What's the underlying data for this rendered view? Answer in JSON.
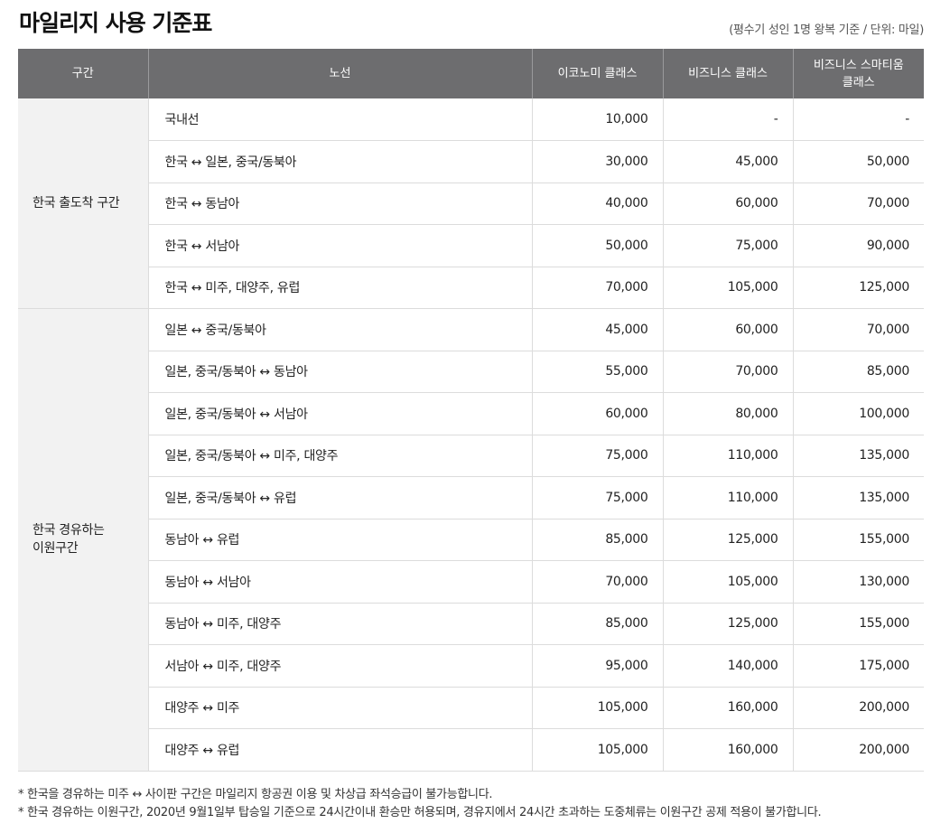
{
  "title": "마일리지 사용 기준표",
  "unit_note": "(평수기 성인 1명 왕복 기준 / 단위: 마일)",
  "headers": [
    "구간",
    "노선",
    "이코노미 클래스",
    "비즈니스 클래스",
    "비즈니스 스마티움\n클래스"
  ],
  "sections": [
    {
      "label": "한국 출도착 구간",
      "rows": [
        {
          "route": "국내선",
          "economy": "10,000",
          "business": "-",
          "smartium": "-"
        },
        {
          "route": "한국 ↔ 일본, 중국/동북아",
          "economy": "30,000",
          "business": "45,000",
          "smartium": "50,000"
        },
        {
          "route": "한국 ↔ 동남아",
          "economy": "40,000",
          "business": "60,000",
          "smartium": "70,000"
        },
        {
          "route": "한국 ↔ 서남아",
          "economy": "50,000",
          "business": "75,000",
          "smartium": "90,000"
        },
        {
          "route": "한국 ↔ 미주, 대양주, 유럽",
          "economy": "70,000",
          "business": "105,000",
          "smartium": "125,000"
        }
      ]
    },
    {
      "label": "한국 경유하는\n이원구간",
      "rows": [
        {
          "route": "일본 ↔ 중국/동북아",
          "economy": "45,000",
          "business": "60,000",
          "smartium": "70,000"
        },
        {
          "route": "일본, 중국/동북아 ↔ 동남아",
          "economy": "55,000",
          "business": "70,000",
          "smartium": "85,000"
        },
        {
          "route": "일본, 중국/동북아 ↔ 서남아",
          "economy": "60,000",
          "business": "80,000",
          "smartium": "100,000"
        },
        {
          "route": "일본, 중국/동북아 ↔ 미주, 대양주",
          "economy": "75,000",
          "business": "110,000",
          "smartium": "135,000"
        },
        {
          "route": "일본, 중국/동북아 ↔ 유럽",
          "economy": "75,000",
          "business": "110,000",
          "smartium": "135,000"
        },
        {
          "route": "동남아 ↔ 유럽",
          "economy": "85,000",
          "business": "125,000",
          "smartium": "155,000"
        },
        {
          "route": "동남아 ↔ 서남아",
          "economy": "70,000",
          "business": "105,000",
          "smartium": "130,000"
        },
        {
          "route": "동남아 ↔ 미주, 대양주",
          "economy": "85,000",
          "business": "125,000",
          "smartium": "155,000"
        },
        {
          "route": "서남아 ↔ 미주, 대양주",
          "economy": "95,000",
          "business": "140,000",
          "smartium": "175,000"
        },
        {
          "route": "대양주 ↔ 미주",
          "economy": "105,000",
          "business": "160,000",
          "smartium": "200,000"
        },
        {
          "route": "대양주 ↔ 유럽",
          "economy": "105,000",
          "business": "160,000",
          "smartium": "200,000"
        }
      ]
    }
  ],
  "notes": [
    "* 한국을 경유하는 미주 ↔ 사이판 구간은 마일리지 항공권 이용 및 차상급 좌석승급이 불가능합니다.",
    "* 한국 경유하는 이원구간, 2020년 9월1일부 탑승일 기준으로 24시간이내 환승만 허용되며, 경유지에서 24시간 초과하는 도중체류는 이원구간 공제 적용이 불가합니다."
  ]
}
